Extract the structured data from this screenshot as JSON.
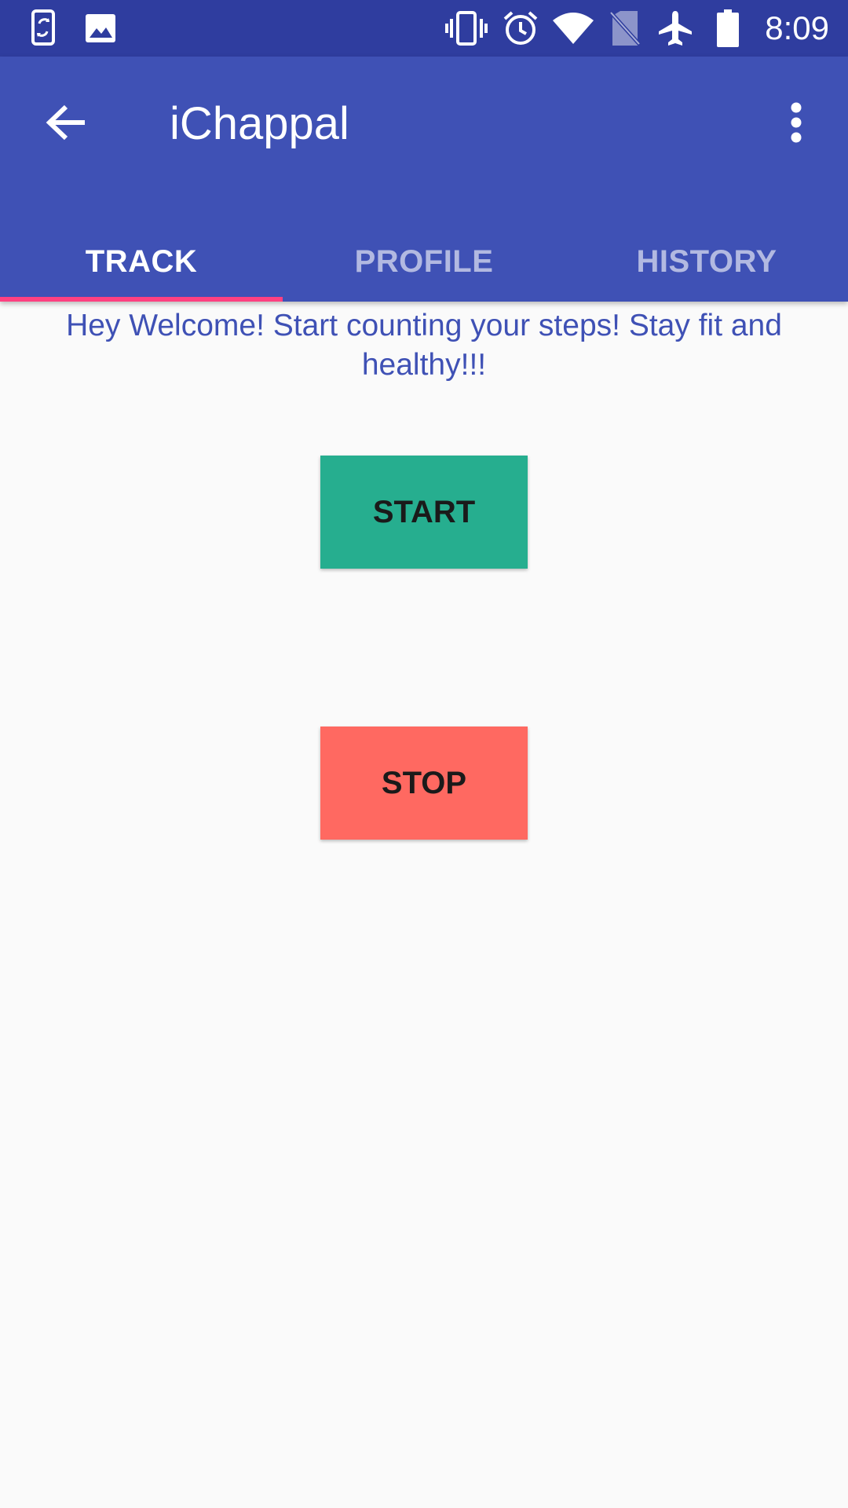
{
  "status_bar": {
    "time": "8:09",
    "icons": [
      "screen-rotation-icon",
      "image-icon",
      "vibrate-icon",
      "alarm-icon",
      "wifi-icon",
      "no-sim-icon",
      "airplane-mode-icon",
      "battery-icon"
    ]
  },
  "app_bar": {
    "title": "iChappal",
    "back_icon": "back-arrow-icon",
    "menu_icon": "overflow-menu-icon"
  },
  "tabs": [
    {
      "label": "TRACK",
      "active": true
    },
    {
      "label": "PROFILE",
      "active": false
    },
    {
      "label": "HISTORY",
      "active": false
    }
  ],
  "main": {
    "welcome": "Hey Welcome! Start counting your steps! Stay fit and healthy!!!",
    "start_label": "START",
    "stop_label": "STOP"
  },
  "colors": {
    "status_bar": "#2f3d9f",
    "primary": "#3f51b5",
    "accent": "#ff4081",
    "start_button": "#26ae8f",
    "stop_button": "#ff6961",
    "background": "#fafafa"
  }
}
